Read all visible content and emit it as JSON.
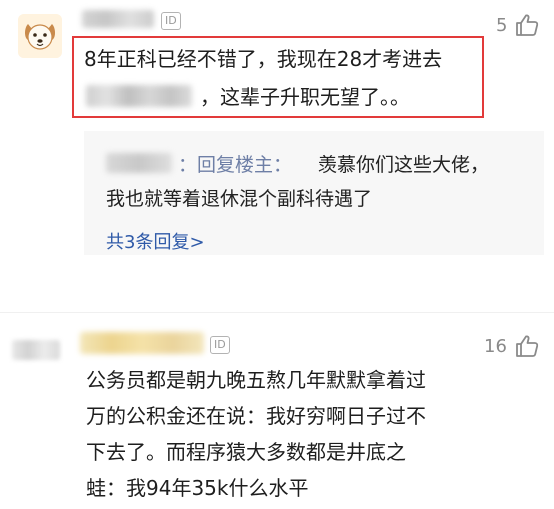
{
  "comment1": {
    "id_badge": "ID",
    "likes": "5",
    "line1": "8年正科已经不错了，我现在28才考进去",
    "line2": "，这辈子升职无望了。。",
    "reply": {
      "separator": "：回复楼主：",
      "line1": "羡慕你们这些大佬，",
      "line2": "我也就等着退休混个副科待遇了",
      "more_link": "共3条回复>"
    }
  },
  "comment2": {
    "id_badge": "ID",
    "likes": "16",
    "lines": [
      "公务员都是朝九晚五熬几年默默拿着过",
      "万的公积金还在说：我好穷啊日子过不",
      "下去了。而程序猿大多数都是井底之",
      "蛙：我94年35k什么水平"
    ]
  },
  "colors": {
    "highlight_border": "#e23a3a",
    "link": "#2f5aa8",
    "reply_background": "#f7f7f7",
    "muted": "#8a8a8a"
  },
  "icons": {
    "like": "thumbs-up-icon",
    "avatar1": "dog-face-icon"
  }
}
